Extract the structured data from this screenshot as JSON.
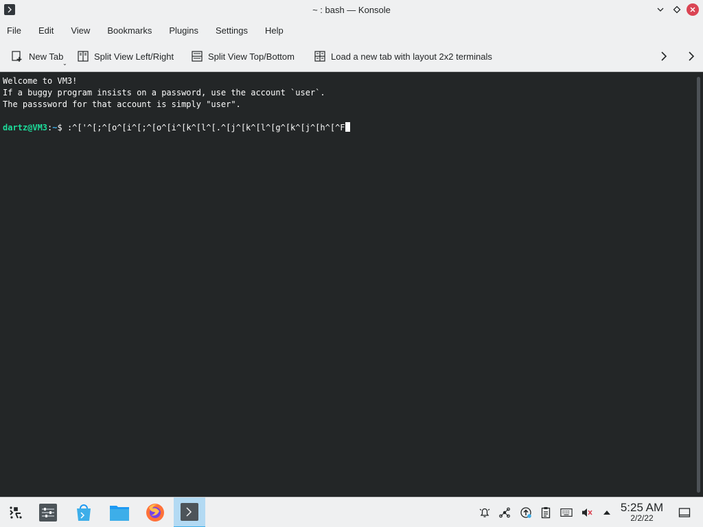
{
  "window": {
    "title": "~ : bash — Konsole",
    "app_icon": "konsole-icon",
    "controls": [
      "minimize-icon",
      "maximize-icon",
      "close-icon"
    ]
  },
  "menu": [
    "File",
    "Edit",
    "View",
    "Bookmarks",
    "Plugins",
    "Settings",
    "Help"
  ],
  "toolbar": {
    "new_tab": "New Tab",
    "split_lr": "Split View Left/Right",
    "split_tb": "Split View Top/Bottom",
    "layout": "Load a new tab with layout 2x2 terminals"
  },
  "terminal": {
    "lines": [
      "Welcome to VM3!",
      "If a buggy program insists on a password, use the account `user`.",
      "The passsword for that account is simply \"user\".",
      ""
    ],
    "prompt_user": "dartz@VM3",
    "prompt_sep": ":",
    "prompt_path": "~",
    "prompt_symbol": "$ ",
    "input": ":^['^[;^[o^[i^[;^[o^[i^[k^[l^[.^[j^[k^[l^[g^[k^[j^[h^[^F"
  },
  "taskbar": {
    "items": [
      "application-launcher-icon",
      "system-settings-icon",
      "discover-icon",
      "dolphin-folder-icon",
      "firefox-icon",
      "konsole-task-icon"
    ],
    "tray": [
      "notifications-icon",
      "network-icon",
      "updates-icon",
      "clipboard-icon",
      "keyboard-icon",
      "volume-muted-icon",
      "tray-expand-icon"
    ],
    "time": "5:25 AM",
    "date": "2/2/22"
  },
  "colors": {
    "accent": "#3daee9",
    "terminal_bg": "#232627",
    "prompt_user": "#1cdc9a",
    "close_button": "#da4453"
  }
}
